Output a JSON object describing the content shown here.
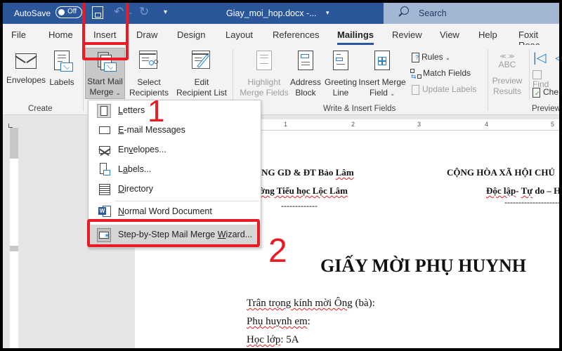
{
  "titlebar": {
    "autosave_label": "AutoSave",
    "autosave_state": "Off",
    "document_title": "Giay_moi_hop.docx -...",
    "search_placeholder": "Search"
  },
  "tabs": [
    {
      "label": "File"
    },
    {
      "label": "Home"
    },
    {
      "label": "Insert"
    },
    {
      "label": "Draw"
    },
    {
      "label": "Design"
    },
    {
      "label": "Layout"
    },
    {
      "label": "References"
    },
    {
      "label": "Mailings",
      "active": true
    },
    {
      "label": "Review"
    },
    {
      "label": "View"
    },
    {
      "label": "Help"
    },
    {
      "label": "Foxit Reac"
    }
  ],
  "ribbon": {
    "create": {
      "group_label": "Create",
      "envelopes": "Envelopes",
      "labels": "Labels"
    },
    "start_merge": {
      "start_mail_merge_line1": "Start Mail",
      "start_mail_merge_line2": "Merge",
      "select_recipients_line1": "Select",
      "select_recipients_line2": "Recipients",
      "edit_list_line1": "Edit",
      "edit_list_line2": "Recipient List"
    },
    "write_insert": {
      "group_label": "Write & Insert Fields",
      "highlight_line1": "Highlight",
      "highlight_line2": "Merge Fields",
      "address_line1": "Address",
      "address_line2": "Block",
      "greeting_line1": "Greeting",
      "greeting_line2": "Line",
      "insert_field_line1": "Insert Merge",
      "insert_field_line2": "Field",
      "rules": "Rules",
      "match_fields": "Match Fields",
      "update_labels": "Update Labels"
    },
    "preview": {
      "group_label": "Preview",
      "abc": "ABC",
      "preview_line1": "Preview",
      "preview_line2": "Results",
      "find": "Find",
      "check": "Che"
    }
  },
  "menu": {
    "items": [
      {
        "label_pre": "",
        "label_u": "L",
        "label_post": "etters"
      },
      {
        "label_pre": "",
        "label_u": "E",
        "label_post": "-mail Messages"
      },
      {
        "label_pre": "En",
        "label_u": "v",
        "label_post": "elopes..."
      },
      {
        "label_pre": "L",
        "label_u": "a",
        "label_post": "bels..."
      },
      {
        "label_pre": "",
        "label_u": "D",
        "label_post": "irectory"
      },
      {
        "label_pre": "",
        "label_u": "N",
        "label_post": "ormal Word Document"
      },
      {
        "label_pre": "Step-by-Step Mail Merge ",
        "label_u": "W",
        "label_post": "izard..."
      }
    ]
  },
  "ruler": {
    "ticks": [
      "1",
      "2",
      "3",
      "4",
      "5"
    ]
  },
  "document": {
    "left_header_1": "ÒNG GD & ĐT Bảo ",
    "left_header_1_sq": "Lâm",
    "left_header_2_sq": "ường Tiểu học Lộc Lâm",
    "left_dashes": "-------------",
    "right_header_1": "CỘNG HÒA XÃ HỘI CHỦ",
    "right_header_2_sq1": "Độc lập",
    "right_header_2_mid": "- ",
    "right_header_2_sq2": "Tự",
    "right_header_2_end": " do – H",
    "right_dashes": "------------------------",
    "title": "GIẤY MỜI PHỤ HUYNH",
    "line1_sq": "Trân trọng kính mời Ông",
    "line1_end": " (bà):",
    "line2_sq": "Phụ huynh em",
    "line2_end": ":",
    "line3_sq": "Học lớp",
    "line3_end": ": 5A"
  },
  "annotations": {
    "step1": "1",
    "step2": "2"
  },
  "colors": {
    "accent": "#2b579a",
    "annotation_red": "#e81c24",
    "search_bg": "#a3b6d4"
  }
}
